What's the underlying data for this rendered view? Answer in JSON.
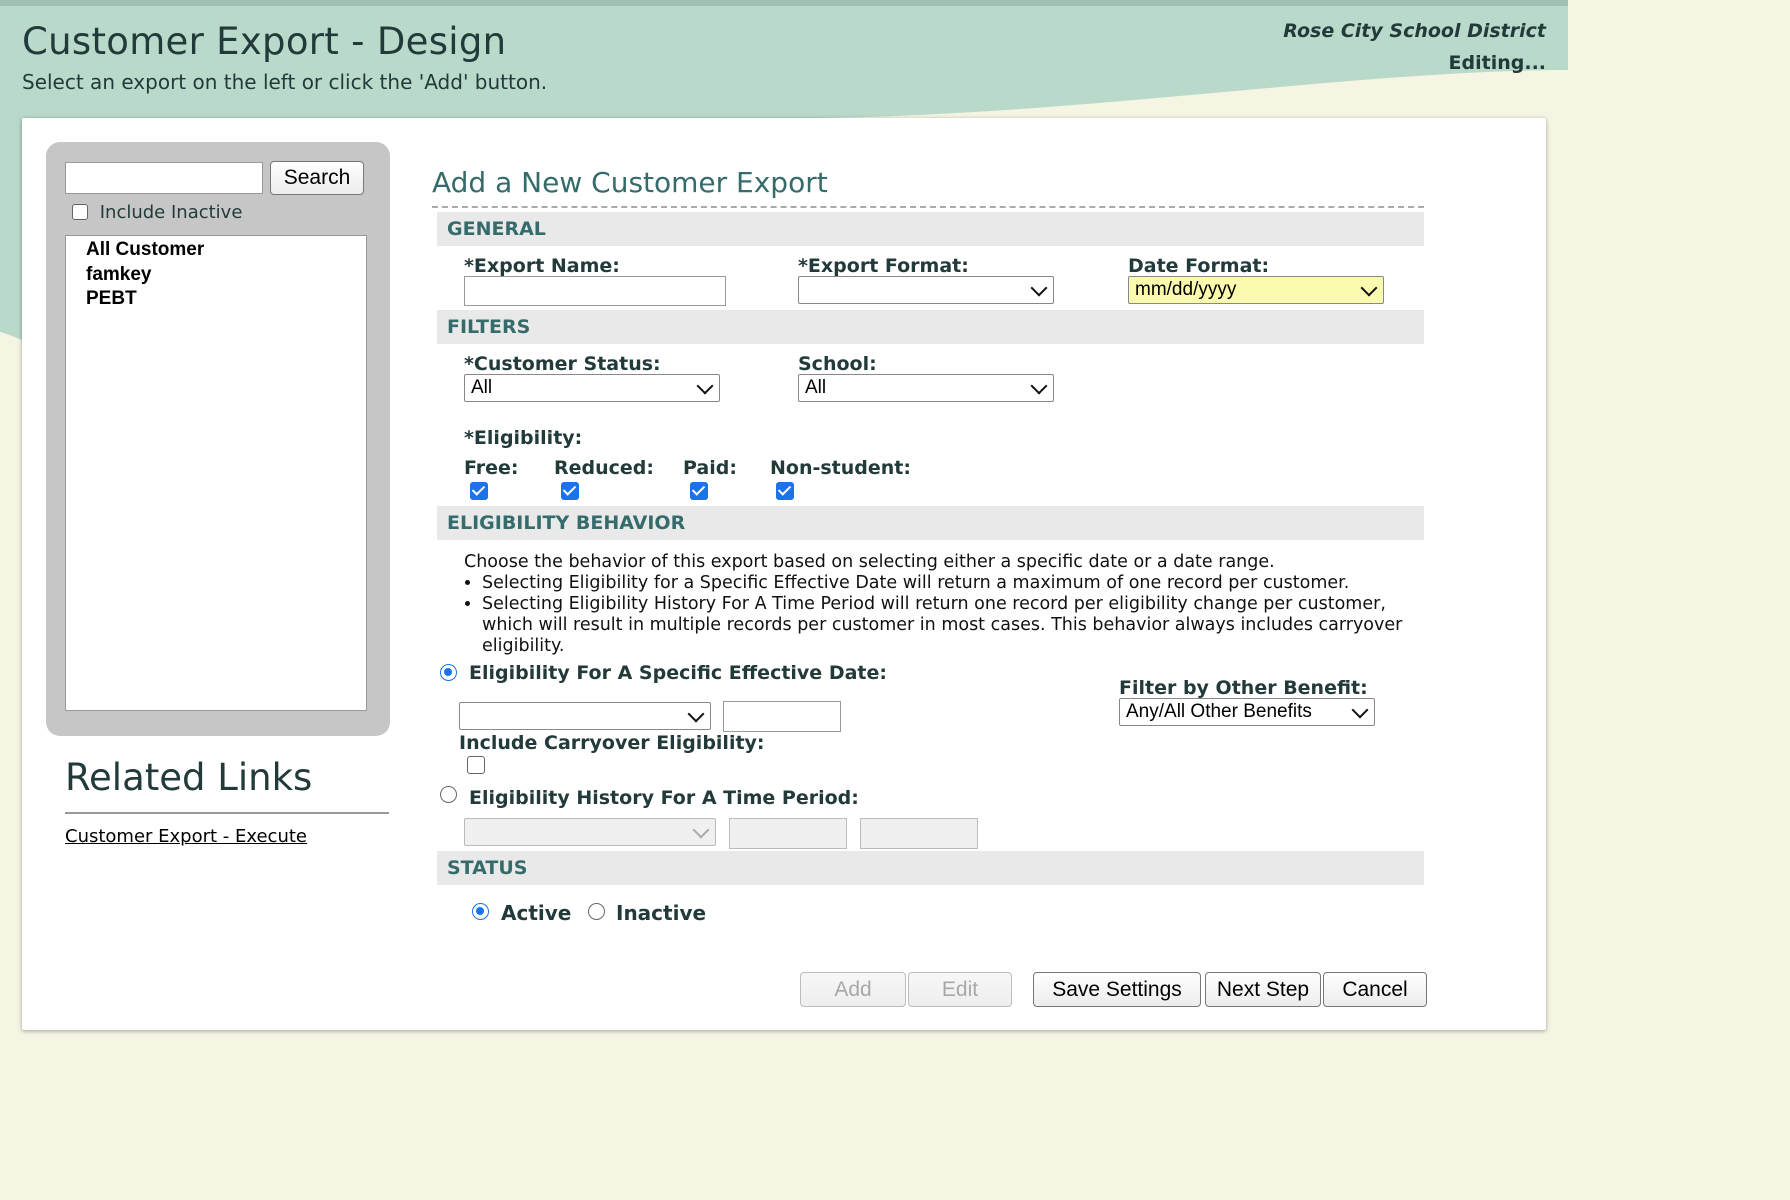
{
  "header": {
    "title": "Customer Export - Design",
    "subtitle": "Select an export on the left or click the 'Add' button.",
    "district": "Rose City School District",
    "status": "Editing..."
  },
  "sidebar": {
    "search_placeholder": "",
    "search_button": "Search",
    "include_inactive_label": "Include Inactive",
    "include_inactive_checked": false,
    "exports": [
      "All Customer",
      "famkey",
      "PEBT"
    ]
  },
  "related": {
    "title": "Related Links",
    "links": [
      "Customer Export - Execute"
    ]
  },
  "form": {
    "title": "Add a New Customer Export",
    "sections": {
      "general": "GENERAL",
      "filters": "FILTERS",
      "eligibility_behavior": "ELIGIBILITY BEHAVIOR",
      "status": "STATUS"
    },
    "general": {
      "export_name_label": "*Export Name:",
      "export_name_value": "",
      "export_format_label": "*Export Format:",
      "export_format_value": "",
      "date_format_label": "Date Format:",
      "date_format_value": "mm/dd/yyyy"
    },
    "filters": {
      "customer_status_label": "*Customer Status:",
      "customer_status_value": "All",
      "school_label": "School:",
      "school_value": "All",
      "eligibility_label": "*Eligibility:",
      "eligibility_options": [
        {
          "label": "Free:",
          "checked": true
        },
        {
          "label": "Reduced:",
          "checked": true
        },
        {
          "label": "Paid:",
          "checked": true
        },
        {
          "label": "Non-student:",
          "checked": true
        }
      ]
    },
    "behavior": {
      "intro": "Choose the behavior of this export based on selecting either a specific date or a date range.",
      "bullets": [
        "Selecting Eligibility for a Specific Effective Date will return a maximum of one record per customer.",
        "Selecting Eligibility History For A Time Period will return one record per eligibility change per customer, which will result in multiple records per customer in most cases. This behavior always includes carryover eligibility."
      ],
      "specific_date_label": "Eligibility For A Specific Effective Date:",
      "specific_date_selected": true,
      "specific_date_select_value": "",
      "specific_date_value": "",
      "carryover_label": "Include Carryover Eligibility:",
      "carryover_checked": false,
      "history_label": "Eligibility History For A Time Period:",
      "history_selected": false,
      "other_benefit_label": "Filter by Other Benefit:",
      "other_benefit_value": "Any/All Other Benefits"
    },
    "status": {
      "options": [
        {
          "label": "Active",
          "selected": true
        },
        {
          "label": "Inactive",
          "selected": false
        }
      ]
    },
    "buttons": {
      "add": "Add",
      "edit": "Edit",
      "save": "Save Settings",
      "next": "Next Step",
      "cancel": "Cancel"
    }
  },
  "colors": {
    "header_green": "#b9d9ca",
    "background_cream": "#f6f5e3",
    "heading_teal": "#356b6b",
    "checkbox_blue": "#1a73e8",
    "date_format_highlight": "#fbfbb0"
  }
}
